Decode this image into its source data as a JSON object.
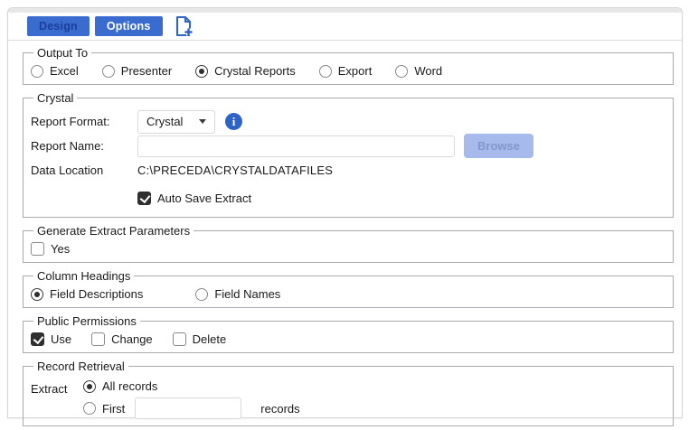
{
  "tabs": {
    "design": {
      "label": "Design",
      "active": false
    },
    "options": {
      "label": "Options",
      "active": true
    }
  },
  "icons": {
    "new_tab": "new-page-plus-icon",
    "info": "i",
    "select_caret": "caret-down"
  },
  "colors": {
    "tab_blue": "#3a6bce",
    "tab_inactive_text": "#1c3f9e",
    "info_blue": "#2e63c8",
    "browse_bg": "#a7baec",
    "check_dark": "#2f2f2f"
  },
  "sections": {
    "output_to": {
      "legend": "Output To",
      "options": [
        {
          "label": "Excel",
          "selected": false
        },
        {
          "label": "Presenter",
          "selected": false
        },
        {
          "label": "Crystal Reports",
          "selected": true
        },
        {
          "label": "Export",
          "selected": false
        },
        {
          "label": "Word",
          "selected": false
        }
      ]
    },
    "crystal": {
      "legend": "Crystal",
      "report_format_label": "Report Format:",
      "report_format_value": "Crystal",
      "report_name_label": "Report Name:",
      "report_name_value": "",
      "browse_label": "Browse",
      "data_location_label": "Data Location",
      "data_location_value": "C:\\PRECEDA\\CRYSTALDATAFILES",
      "auto_save": {
        "label": "Auto Save Extract",
        "checked": true
      }
    },
    "generate_extract": {
      "legend": "Generate Extract Parameters",
      "yes": {
        "label": "Yes",
        "checked": false
      }
    },
    "column_headings": {
      "legend": "Column Headings",
      "options": [
        {
          "label": "Field Descriptions",
          "selected": true
        },
        {
          "label": "Field Names",
          "selected": false
        }
      ]
    },
    "public_permissions": {
      "legend": "Public Permissions",
      "options": [
        {
          "label": "Use",
          "checked": true
        },
        {
          "label": "Change",
          "checked": false
        },
        {
          "label": "Delete",
          "checked": false
        }
      ]
    },
    "record_retrieval": {
      "legend": "Record Retrieval",
      "extract_label": "Extract",
      "all_records": {
        "label": "All records",
        "selected": true
      },
      "first": {
        "label": "First",
        "selected": false,
        "value": "",
        "suffix": "records"
      }
    }
  }
}
